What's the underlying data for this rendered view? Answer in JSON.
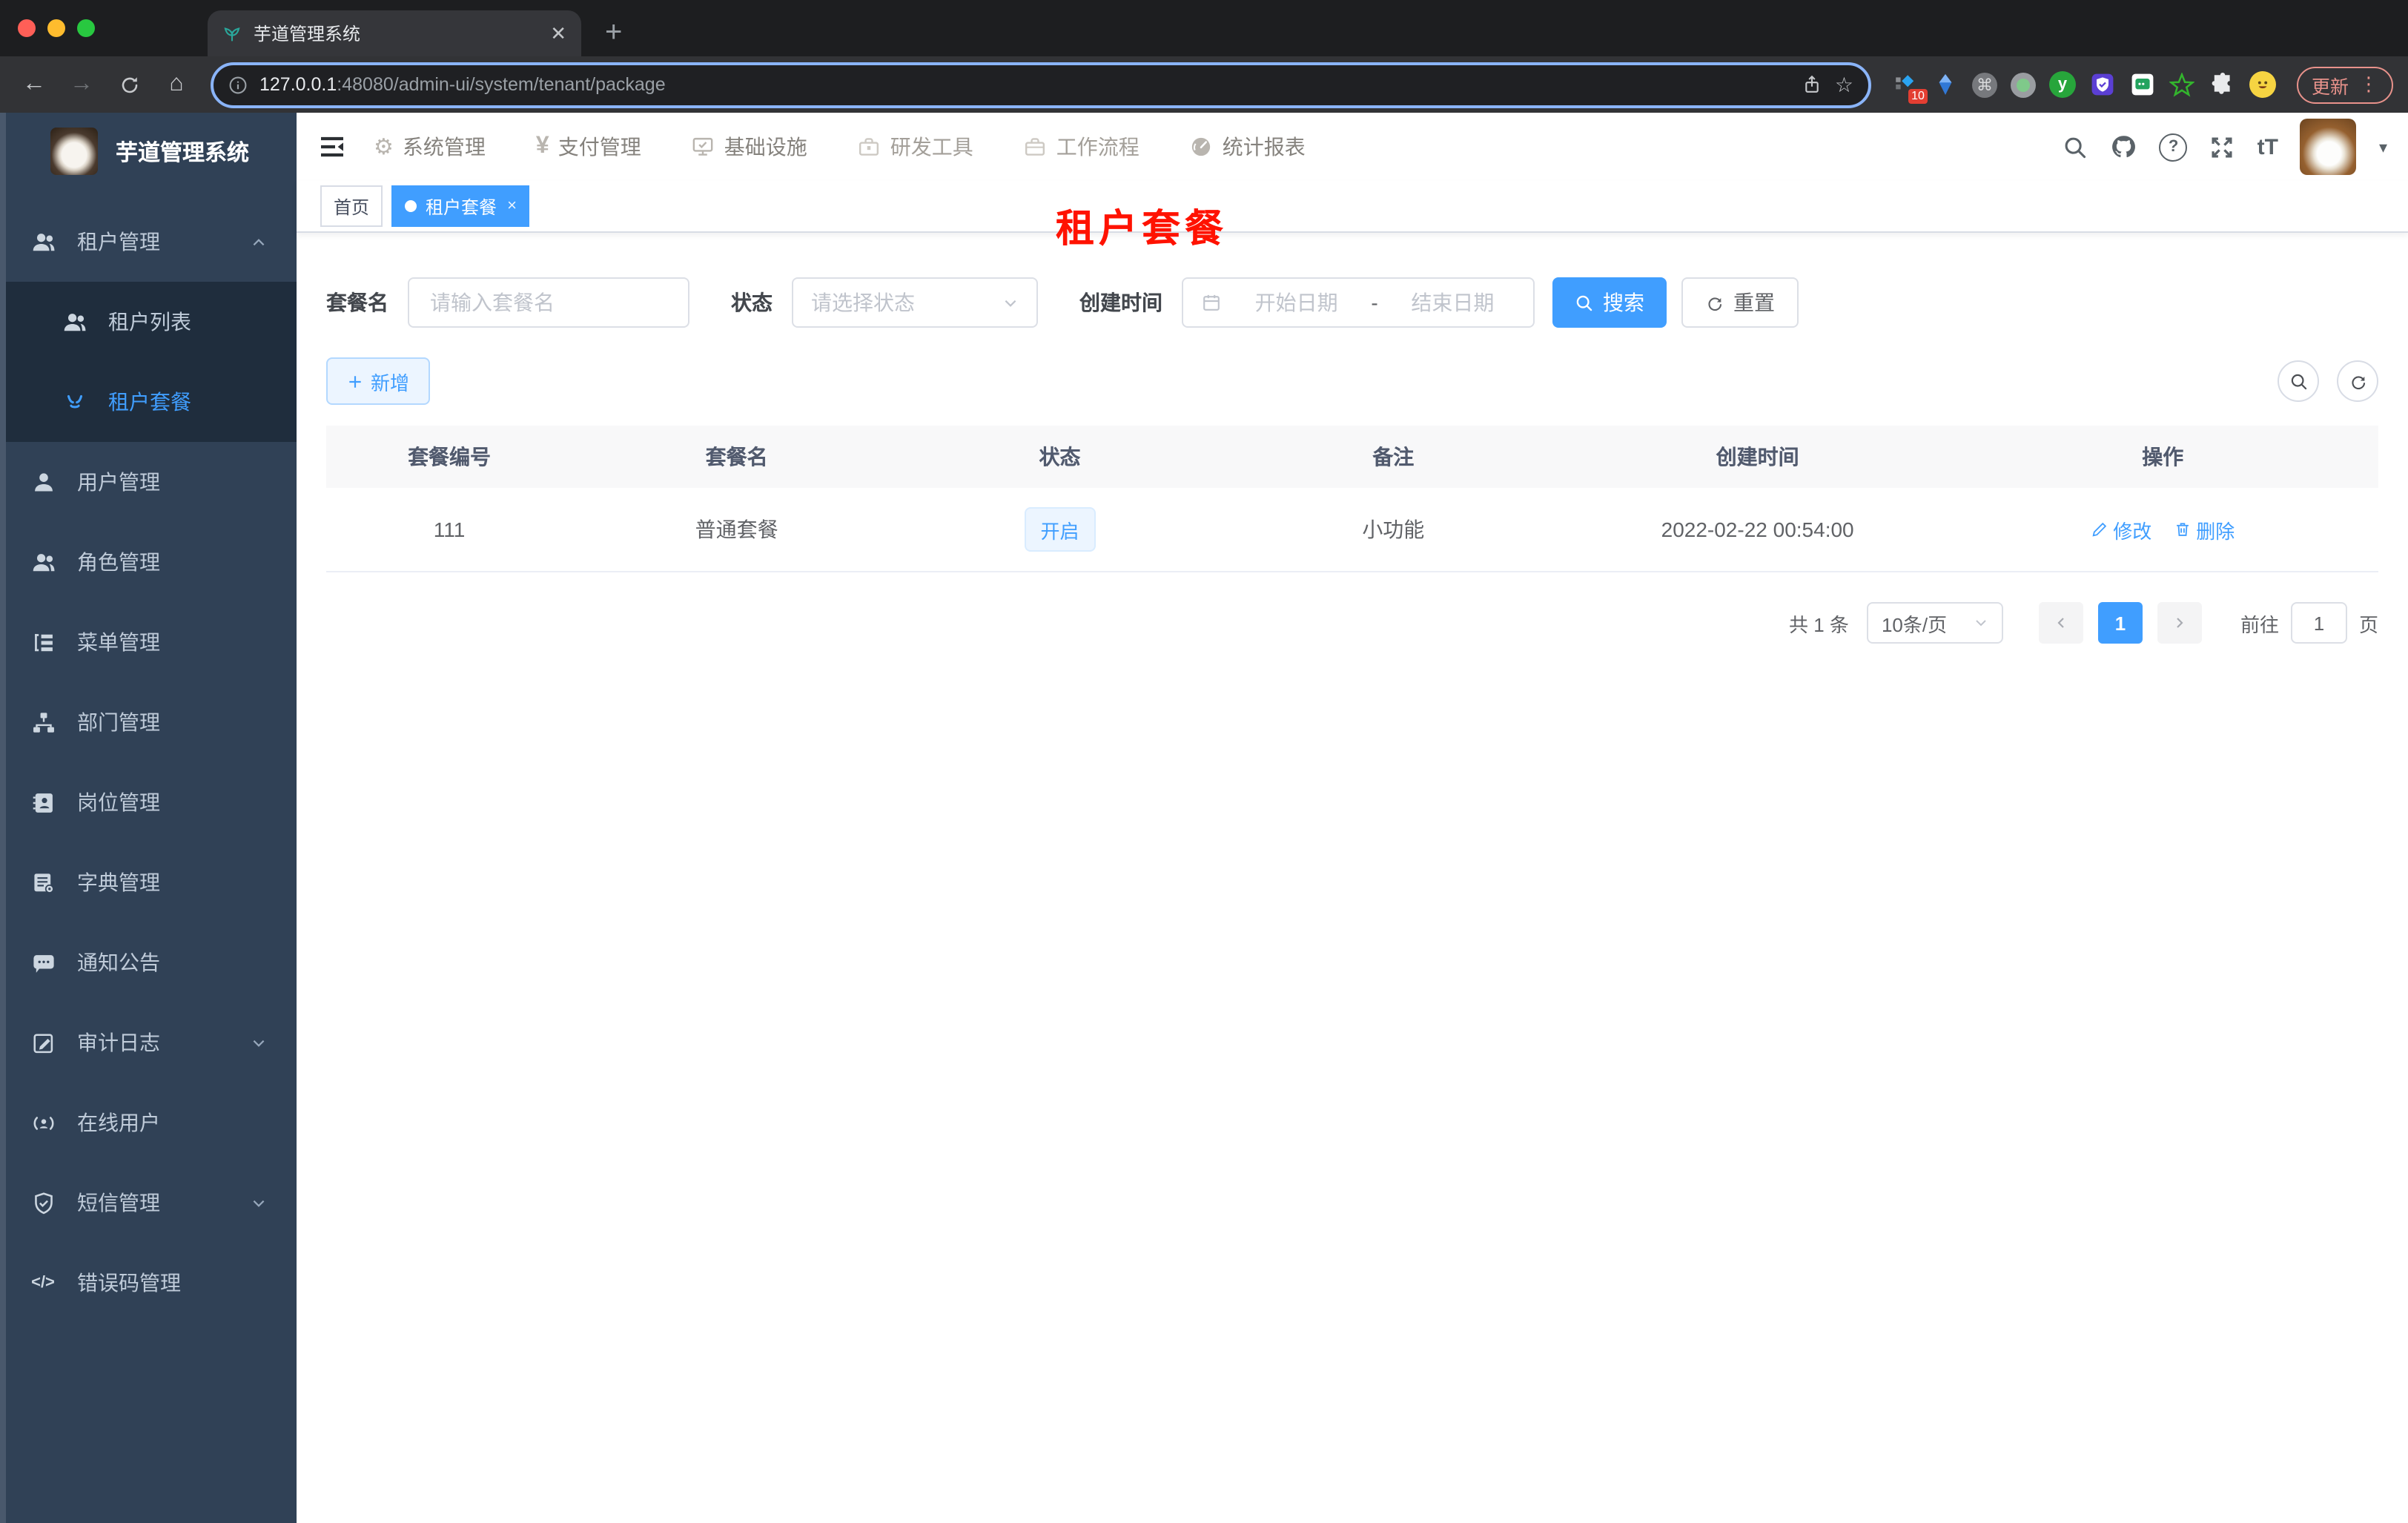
{
  "browser": {
    "tab_title": "芋道管理系统",
    "url": {
      "host": "127.0.0.1",
      "rest": ":48080/admin-ui/system/tenant/package"
    },
    "extension_badge": "10",
    "extension_y": "y",
    "command_glyph": "⌘",
    "update_label": "更新"
  },
  "sidebar": {
    "logo_title": "芋道管理系统",
    "items": [
      {
        "label": "租户管理",
        "icon": "users-icon",
        "expanded": true,
        "children": [
          {
            "label": "租户列表",
            "icon": "users-icon"
          },
          {
            "label": "租户套餐",
            "icon": "peace-icon",
            "active": true
          }
        ]
      },
      {
        "label": "用户管理",
        "icon": "user-icon"
      },
      {
        "label": "角色管理",
        "icon": "users-icon"
      },
      {
        "label": "菜单管理",
        "icon": "menu-tree-icon"
      },
      {
        "label": "部门管理",
        "icon": "org-icon"
      },
      {
        "label": "岗位管理",
        "icon": "badge-icon"
      },
      {
        "label": "字典管理",
        "icon": "dict-icon"
      },
      {
        "label": "通知公告",
        "icon": "notice-icon"
      },
      {
        "label": "审计日志",
        "icon": "log-icon",
        "has_children": true
      },
      {
        "label": "在线用户",
        "icon": "online-icon"
      },
      {
        "label": "短信管理",
        "icon": "shield-icon",
        "has_children": true
      },
      {
        "label": "错误码管理",
        "icon": "code-icon",
        "code_glyph": "</>"
      }
    ]
  },
  "topnav": {
    "items": [
      {
        "label": "系统管理",
        "icon": "gear-icon",
        "glyph": "⚙"
      },
      {
        "label": "支付管理",
        "icon": "yen-icon",
        "glyph": "¥"
      },
      {
        "label": "基础设施",
        "icon": "monitor-icon"
      },
      {
        "label": "研发工具",
        "icon": "toolbox-icon"
      },
      {
        "label": "工作流程",
        "icon": "briefcase-icon"
      },
      {
        "label": "统计报表",
        "icon": "gauge-icon"
      }
    ],
    "fontsize_glyph": "tT"
  },
  "tags": {
    "home": "首页",
    "active_label": "租户套餐",
    "close_glyph": "×"
  },
  "annotation": {
    "title": "租户套餐"
  },
  "filter": {
    "name_label": "套餐名",
    "name_placeholder": "请输入套餐名",
    "status_label": "状态",
    "status_placeholder": "请选择状态",
    "created_label": "创建时间",
    "start_placeholder": "开始日期",
    "separator": "-",
    "end_placeholder": "结束日期",
    "search_label": "搜索",
    "reset_label": "重置"
  },
  "toolbar": {
    "add_label": "新增"
  },
  "table": {
    "headers": [
      "套餐编号",
      "套餐名",
      "状态",
      "备注",
      "创建时间",
      "操作"
    ],
    "rows": [
      {
        "id": "111",
        "name": "普通套餐",
        "status": "开启",
        "remark": "小功能",
        "created_at": "2022-02-22 00:54:00",
        "edit_label": "修改",
        "delete_label": "删除"
      }
    ]
  },
  "pagination": {
    "total": "共 1 条",
    "page_size": "10条/页",
    "current_page": "1",
    "goto_label": "前往",
    "goto_value": "1",
    "unit_label": "页"
  },
  "colors": {
    "accent": "#409eff",
    "sidebar_bg": "#304156",
    "submenu_bg": "#1f2d3d",
    "annotation_red": "#ff1200",
    "tab_active": "#409eff"
  }
}
